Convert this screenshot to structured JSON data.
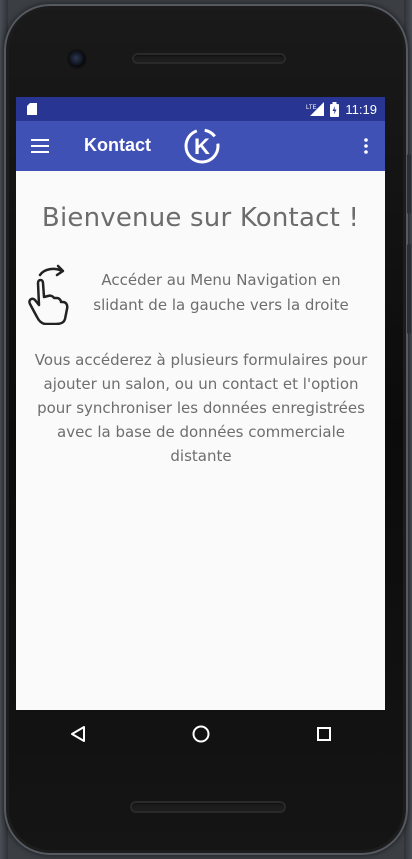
{
  "status_bar": {
    "network": "LTE",
    "time": "11:19"
  },
  "app_bar": {
    "title": "Kontact",
    "logo_letter": "K",
    "color": "#3f51b5",
    "status_color": "#283593"
  },
  "content": {
    "welcome": "Bienvenue sur Kontact !",
    "swipe_hint": "Accéder au Menu Navigation en slidant de la gauche vers la droite",
    "description": "Vous accéderez à plusieurs formulaires pour ajouter un salon, ou un contact et l'option pour synchroniser les données enregistrées avec la base de données commerciale distante"
  },
  "icons": {
    "menu": "hamburger-icon",
    "overflow": "more-vert-icon",
    "hand": "swipe-hand-icon",
    "back": "back-triangle-icon",
    "home": "home-circle-icon",
    "recents": "recents-square-icon"
  }
}
